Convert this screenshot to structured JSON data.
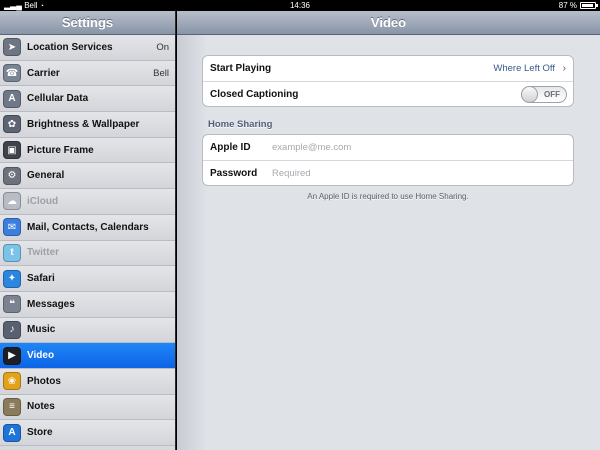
{
  "status": {
    "carrier": "Bell",
    "time": "14:36",
    "battery": "87 %"
  },
  "sidebar": {
    "title": "Settings",
    "items": [
      {
        "label": "Location Services",
        "value": "On",
        "icon": "location-arrow-icon",
        "color": "#6e7684",
        "glyph": "➤"
      },
      {
        "label": "Carrier",
        "value": "Bell",
        "icon": "phone-icon",
        "color": "#7b8493",
        "glyph": "☎"
      },
      {
        "label": "Cellular Data",
        "value": "",
        "icon": "antenna-icon",
        "color": "#6f7886",
        "glyph": "A"
      },
      {
        "label": "Brightness & Wallpaper",
        "value": "",
        "icon": "flower-icon",
        "color": "#5d6472",
        "glyph": "✿"
      },
      {
        "label": "Picture Frame",
        "value": "",
        "icon": "picture-frame-icon",
        "color": "#3f444c",
        "glyph": "▣"
      },
      {
        "label": "General",
        "value": "",
        "icon": "gear-icon",
        "color": "#6b727e",
        "glyph": "⚙"
      },
      {
        "label": "iCloud",
        "value": "",
        "icon": "cloud-icon",
        "color": "#b8bcc4",
        "glyph": "☁"
      },
      {
        "label": "Mail, Contacts, Calendars",
        "value": "",
        "icon": "mail-icon",
        "color": "#3b7fdc",
        "glyph": "✉"
      },
      {
        "label": "Twitter",
        "value": "",
        "icon": "bird-icon",
        "color": "#7cc3ea",
        "glyph": "t"
      },
      {
        "label": "Safari",
        "value": "",
        "icon": "compass-icon",
        "color": "#2a86df",
        "glyph": "✦"
      },
      {
        "label": "Messages",
        "value": "",
        "icon": "speech-bubble-icon",
        "color": "#7c8390",
        "glyph": "❝"
      },
      {
        "label": "Music",
        "value": "",
        "icon": "music-note-icon",
        "color": "#596170",
        "glyph": "♪"
      },
      {
        "label": "Video",
        "value": "",
        "icon": "clapperboard-icon",
        "color": "#1b1f26",
        "glyph": "▶"
      },
      {
        "label": "Photos",
        "value": "",
        "icon": "sunflower-icon",
        "color": "#e2a21a",
        "glyph": "❀"
      },
      {
        "label": "Notes",
        "value": "",
        "icon": "notepad-icon",
        "color": "#8a7c5b",
        "glyph": "≡"
      },
      {
        "label": "Store",
        "value": "",
        "icon": "app-store-icon",
        "color": "#1f74d8",
        "glyph": "A"
      }
    ],
    "selected_index": 12,
    "disabled": [
      "iCloud",
      "Twitter"
    ]
  },
  "main": {
    "title": "Video",
    "playback": {
      "start_playing_label": "Start Playing",
      "start_playing_value": "Where Left Off",
      "closed_captioning_label": "Closed Captioning",
      "closed_captioning_state": "OFF"
    },
    "home_sharing": {
      "section_title": "Home Sharing",
      "apple_id_label": "Apple ID",
      "apple_id_placeholder": "example@me.com",
      "password_label": "Password",
      "password_placeholder": "Required",
      "footnote": "An Apple ID is required to use Home Sharing."
    }
  },
  "colors": {
    "selected": "#1276ee",
    "header": "#8895a8"
  }
}
